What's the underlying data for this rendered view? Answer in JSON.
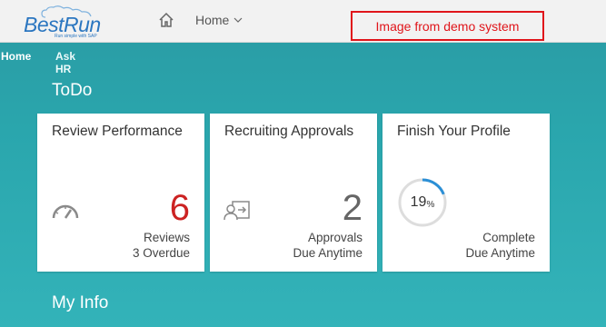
{
  "header": {
    "logo_text": "BestRun",
    "logo_tagline": "Run simple with SAP",
    "nav_label": "Home",
    "demo_notice": "Image from demo system"
  },
  "subnav": {
    "home": "Home",
    "ask_hr": "Ask HR"
  },
  "sections": {
    "todo": "ToDo",
    "my_info": "My Info"
  },
  "tiles": [
    {
      "title": "Review Performance",
      "number": "6",
      "line1": "Reviews",
      "line2": "3 Overdue",
      "icon": "gauge-icon",
      "number_color": "#cc2222"
    },
    {
      "title": "Recruiting Approvals",
      "number": "2",
      "line1": "Approvals",
      "line2": "Due Anytime",
      "icon": "person-transfer-icon",
      "number_color": "#666666"
    },
    {
      "title": "Finish Your Profile",
      "progress_value": "19",
      "progress_unit": "%",
      "progress_fraction": 0.19,
      "line1": "Complete",
      "line2": "Due Anytime",
      "icon": "progress-ring"
    }
  ],
  "colors": {
    "background": "#2aa6ad",
    "tile": "#ffffff",
    "accent_blue": "#2b76c0",
    "demo_red": "#e0151b",
    "progress_blue": "#2b8fd6",
    "progress_track": "#dddddd"
  }
}
